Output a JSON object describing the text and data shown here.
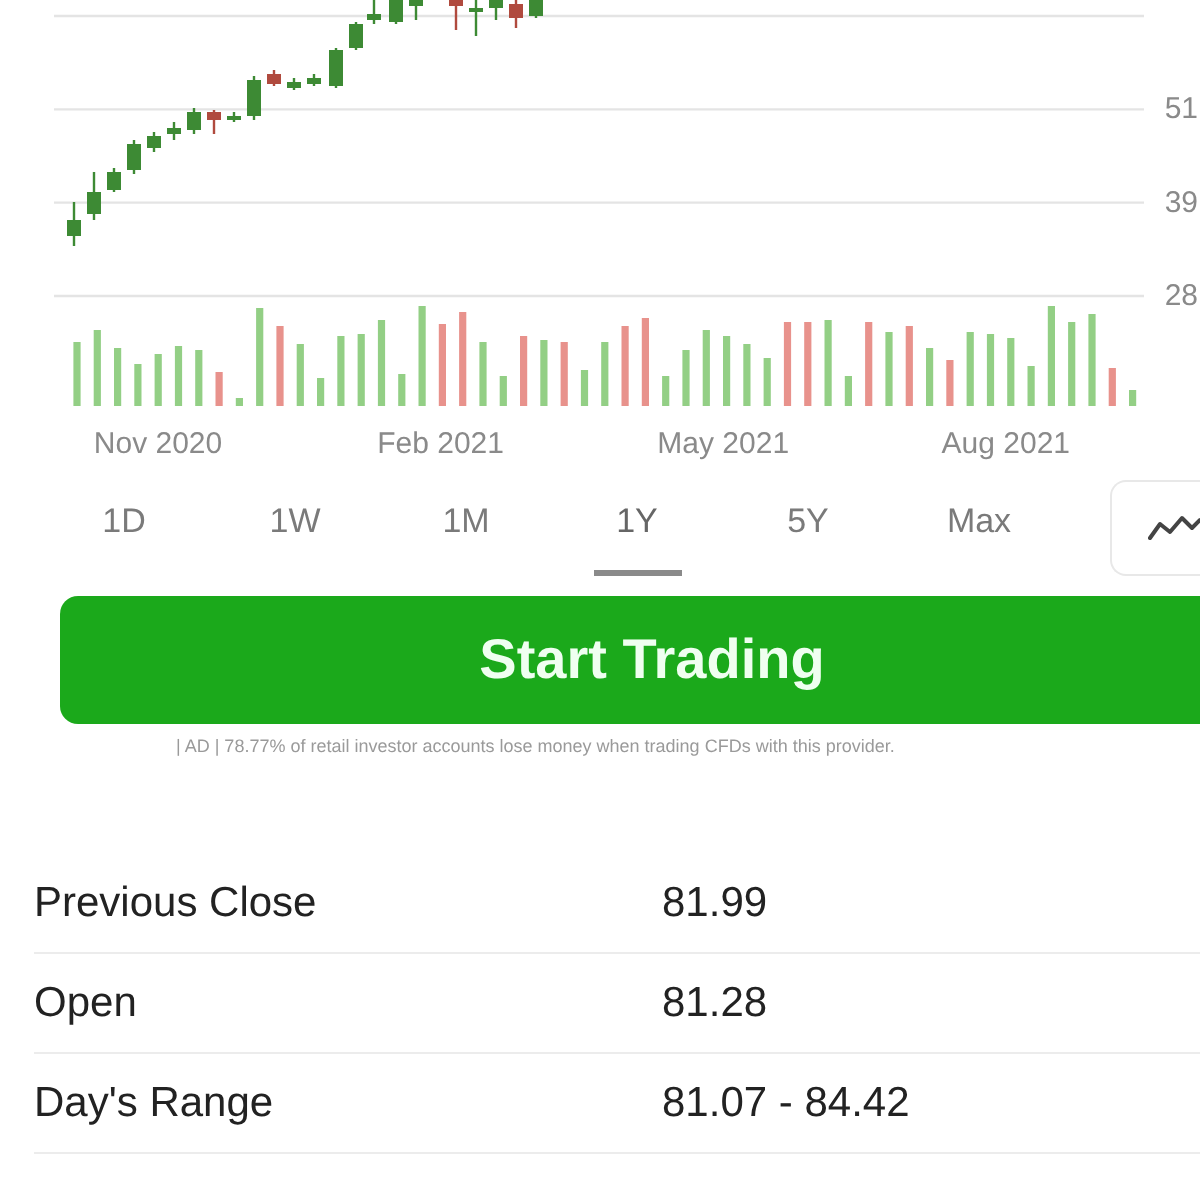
{
  "price_chart": {
    "y_axis_labels": [
      "51",
      "39",
      "28"
    ],
    "x_axis_labels": [
      "Nov 2020",
      "Feb 2021",
      "May 2021",
      "Aug 2021"
    ]
  },
  "range_tabs": [
    {
      "label": "1D",
      "selected": false
    },
    {
      "label": "1W",
      "selected": false
    },
    {
      "label": "1M",
      "selected": false
    },
    {
      "label": "1Y",
      "selected": true
    },
    {
      "label": "5Y",
      "selected": false
    },
    {
      "label": "Max",
      "selected": false
    }
  ],
  "trade_button": {
    "label": "Start Trading"
  },
  "disclaimer": "| AD | 78.77% of retail investor accounts lose money when trading CFDs with this provider.",
  "stats": [
    {
      "label": "Previous Close",
      "value": "81.99"
    },
    {
      "label": "Open",
      "value": "81.28"
    },
    {
      "label": "Day's Range",
      "value": "81.07 - 84.42"
    }
  ]
}
